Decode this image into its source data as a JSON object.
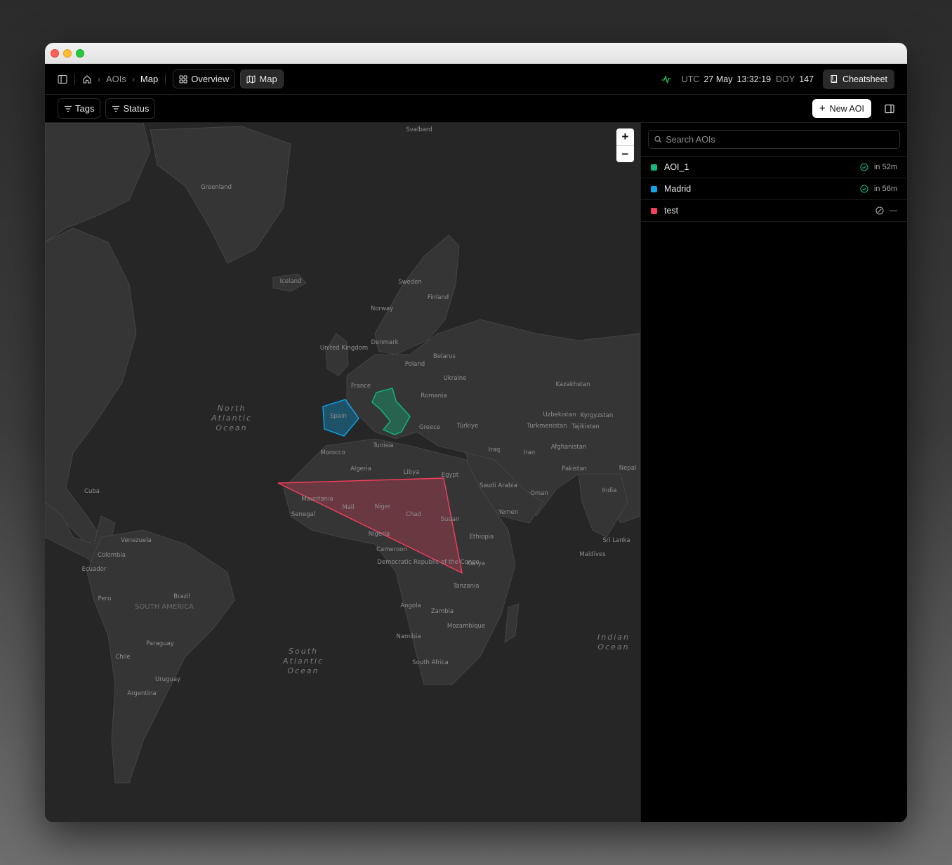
{
  "breadcrumb": {
    "home_icon": "home-icon",
    "aois": "AOIs",
    "map": "Map"
  },
  "views": {
    "overview": "Overview",
    "map": "Map",
    "active": "Map"
  },
  "clock": {
    "utc_label": "UTC",
    "date": "27 May",
    "time": "13:32:19",
    "doy_label": "DOY",
    "doy": "147"
  },
  "cheatsheet_label": "Cheatsheet",
  "filters": {
    "tags": "Tags",
    "status": "Status"
  },
  "new_aoi_label": "New AOI",
  "search": {
    "placeholder": "Search AOIs",
    "value": ""
  },
  "aois": [
    {
      "name": "AOI_1",
      "color": "#10b981",
      "status_icon": "check-circle-icon",
      "status_text": "in 52m"
    },
    {
      "name": "Madrid",
      "color": "#0ea5e9",
      "status_icon": "check-circle-icon",
      "status_text": "in 56m"
    },
    {
      "name": "test",
      "color": "#f43f5e",
      "status_icon": "cancel-circle-icon",
      "status_text": "—"
    }
  ],
  "map": {
    "oceans": [
      "North Atlantic Ocean",
      "South Atlantic Ocean",
      "Indian Ocean"
    ],
    "labels": {
      "svalbard": "Svalbard",
      "greenland": "Greenland",
      "iceland": "Iceland",
      "sweden": "Sweden",
      "finland": "Finland",
      "norway": "Norway",
      "denmark": "Denmark",
      "uk": "United Kingdom",
      "poland": "Poland",
      "belarus": "Belarus",
      "ukraine": "Ukraine",
      "france": "France",
      "romania": "Romania",
      "spain": "Spain",
      "greece": "Greece",
      "turkiye": "Türkiye",
      "kazakhstan": "Kazakhstan",
      "uzbekistan": "Uzbekistan",
      "kyrgyzstan": "Kyrgyzstan",
      "turkmenistan": "Turkmenistan",
      "tajikistan": "Tajikistan",
      "afghanistan": "Afghanistan",
      "iraq": "Iraq",
      "iran": "Iran",
      "pakistan": "Pakistan",
      "nepal": "Nepal",
      "india": "India",
      "tunisia": "Tunisia",
      "morocco": "Morocco",
      "algeria": "Algeria",
      "libya": "Libya",
      "egypt": "Egypt",
      "saudi": "Saudi Arabia",
      "oman": "Oman",
      "yemen": "Yemen",
      "mauritania": "Mauritania",
      "mali": "Mali",
      "niger": "Niger",
      "chad": "Chad",
      "sudan": "Sudan",
      "senegal": "Senegal",
      "nigeria": "Nigeria",
      "ethiopia": "Ethiopia",
      "cameroon": "Cameroon",
      "drc": "Democratic Republic of the Congo",
      "kenya": "Kenya",
      "tanzania": "Tanzania",
      "angola": "Angola",
      "zambia": "Zambia",
      "mozambique": "Mozambique",
      "namibia": "Namibia",
      "south_africa": "South Africa",
      "sri_lanka": "Sri Lanka",
      "maldives": "Maldives",
      "cuba": "Cuba",
      "venezuela": "Venezuela",
      "colombia": "Colombia",
      "ecuador": "Ecuador",
      "peru": "Peru",
      "brazil": "Brazil",
      "south_america": "SOUTH AMERICA",
      "paraguay": "Paraguay",
      "chile": "Chile",
      "uruguay": "Uruguay",
      "argentina": "Argentina"
    }
  }
}
